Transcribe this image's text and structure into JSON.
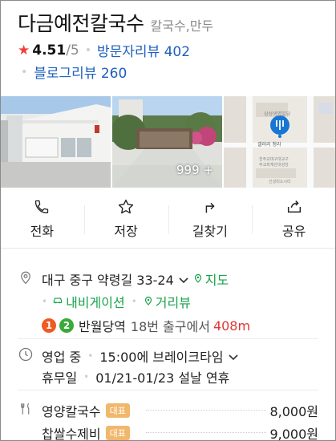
{
  "place": {
    "name": "다금예전칼국수",
    "category": "칼국수,만두",
    "rating": "4.51",
    "rating_max": "/5",
    "visitor_reviews": "방문자리뷰 402",
    "blog_reviews": "블로그리뷰 260"
  },
  "photos": {
    "more_count": "999 +"
  },
  "actions": [
    {
      "label": "전화",
      "icon": "phone-icon"
    },
    {
      "label": "저장",
      "icon": "star-outline-icon"
    },
    {
      "label": "길찾기",
      "icon": "directions-arrow-icon"
    },
    {
      "label": "공유",
      "icon": "share-icon"
    }
  ],
  "info": {
    "address": "대구 중구 약령길 33-24",
    "map_link": "지도",
    "navigation_link": "내비게이션",
    "street_view_link": "거리뷰",
    "subway_line1": "1",
    "subway_line2": "2",
    "station": "반월당역",
    "exit_text": "18번 출구에서",
    "distance": "408m",
    "status": "영업 중",
    "break_time": "15:00에 브레이크타임",
    "holiday_label": "휴무일",
    "holiday_value": "01/21-01/23 설날 연휴"
  },
  "menu": [
    {
      "name": "영양칼국수",
      "tag": "대표",
      "price": "8,000원"
    },
    {
      "name": "찹쌀수제비",
      "tag": "대표",
      "price": "9,000원"
    }
  ],
  "colors": {
    "link_blue": "#1c5fbd",
    "green": "#19a34a",
    "red": "#e03636",
    "star": "#f1403a",
    "line1": "#f15a22",
    "line2": "#3aa93a",
    "tag": "#f1b76b"
  }
}
